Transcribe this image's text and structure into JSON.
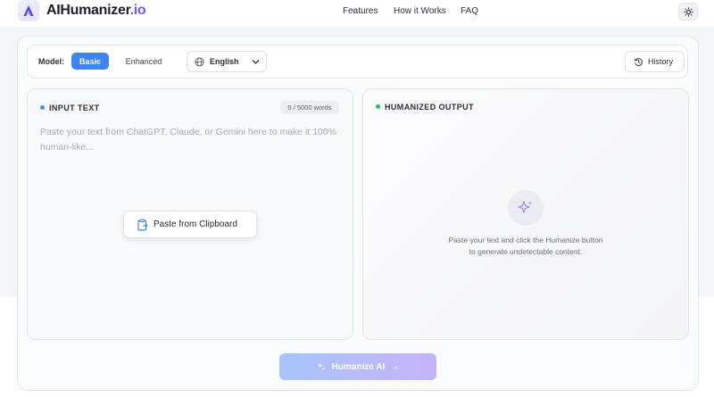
{
  "header": {
    "brand_main": "AIHumanizer",
    "brand_tld": ".io",
    "nav": [
      "Features",
      "How it Works",
      "FAQ"
    ],
    "theme_icon": "sun-icon"
  },
  "toolbar": {
    "model_label": "Model:",
    "model_basic": "Basic",
    "model_enhanced": "Enhanced",
    "language": "English",
    "history": "History"
  },
  "input": {
    "title": "INPUT TEXT",
    "word_count": "0 / 5000 words",
    "placeholder": "Paste your text from ChatGPT, Claude, or Gemini here to make it 100% human-like...",
    "paste_button": "Paste from Clipboard"
  },
  "output": {
    "title": "HUMANIZED OUTPUT",
    "empty_line1": "Paste your text and click the Humanize button",
    "empty_line2": "to generate undetectable content."
  },
  "action": {
    "humanize_label": "Humanize AI",
    "arrow": "→"
  },
  "colors": {
    "accent_blue": "#3d85f5",
    "brand_purple": "#6d5bf6",
    "status_green": "#22c55e"
  }
}
